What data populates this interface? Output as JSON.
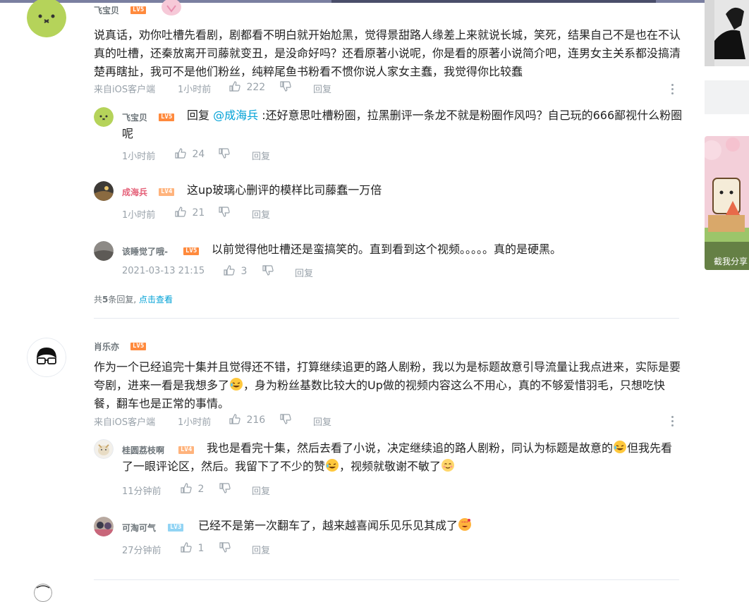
{
  "comments": [
    {
      "user": "飞宝贝",
      "level": "LV5",
      "text": "说真话，劝你吐槽先看剧，剧都看不明白就开始尬黑，觉得景甜路人缘差上来就说长城，笑死，结果自己不是也在不认真的吐槽，还秦放离开司藤就变丑，是没命好吗？还看原著小说呢，你是看的原著小说简介吧，连男女主关系都没搞清楚再瞎扯，我可不是他们粉丝，纯粹尾鱼书粉看不惯你说人家女主蠢，我觉得你比较蠢",
      "source": "来自iOS客户端",
      "time": "1小时前",
      "likes": "222",
      "reply_label": "回复",
      "replies": [
        {
          "user": "飞宝贝",
          "level": "LV5",
          "prefix": "回复 ",
          "mention": "@成海兵",
          "text": " :还好意思吐槽粉圈，拉黑删评一条龙不就是粉圈作风吗？自己玩的666鄙视什么粉圈呢",
          "time": "1小时前",
          "likes": "24",
          "reply_label": "回复"
        },
        {
          "user": "成海兵",
          "level": "LV4",
          "text": "这up玻璃心删评的模样比司藤蠢一万倍",
          "time": "1小时前",
          "likes": "21",
          "reply_label": "回复"
        },
        {
          "user": "该睡觉了哦-",
          "level": "LV5",
          "text": "以前觉得他吐槽还是蛮搞笑的。直到看到这个视频。。。。。真的是硬黑。",
          "time": "2021-03-13 21:15",
          "likes": "3",
          "reply_label": "回复"
        }
      ],
      "summary": {
        "prefix": "共",
        "count": "5",
        "suffix": "条回复,",
        "link": "点击查看"
      }
    },
    {
      "user": "肖乐亦",
      "level": "LV5",
      "text_a": "作为一个已经追完十集并且觉得还不错，打算继续追更的路人剧粉，我以为是标题故意引导流量让我点进来，实际是要夸剧，进来一看是我想多了",
      "text_b": "，身为粉丝基数比较大的Up做的视频内容这么不用心，真的不够爱惜羽毛，只想吃快餐，翻车也是正常的事情。",
      "source": "来自iOS客户端",
      "time": "1小时前",
      "likes": "216",
      "reply_label": "回复",
      "replies": [
        {
          "user": "桂圆荔枝啊",
          "level": "LV4",
          "text_a": "我也是看完十集，然后去看了小说，决定继续追的路人剧粉，同认为标题是故意的",
          "text_b": "但我先看了一眼评论区，然后。我留下了不少的赞",
          "text_c": "，视频就敬谢不敏了",
          "time": "11分钟前",
          "likes": "2",
          "reply_label": "回复"
        },
        {
          "user": "可淘可气",
          "level": "LV3",
          "text": "已经不是第一次翻车了，越来越喜闻乐见乐见其成了",
          "time": "27分钟前",
          "likes": "1",
          "reply_label": "回复"
        }
      ]
    }
  ],
  "sidebar": {
    "caption": "截我分享"
  },
  "colors": {
    "link": "#00a1d6",
    "meta": "#99a2aa",
    "lv5": "#ff8a3d",
    "lv4": "#ffb37c",
    "lv3": "#92d4f4"
  }
}
